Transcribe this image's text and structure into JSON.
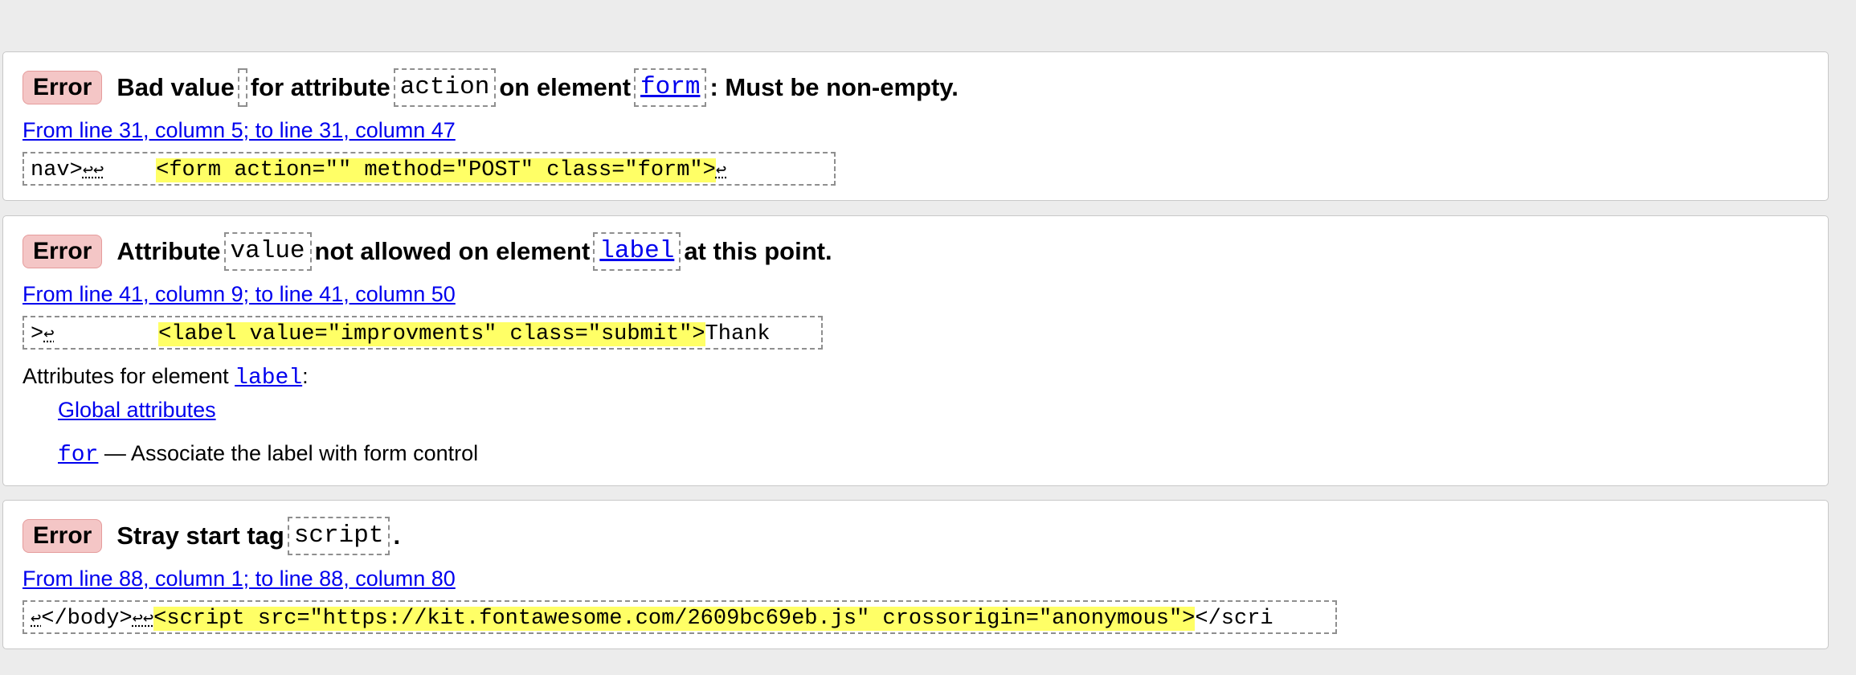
{
  "colors": {
    "page_bg": "#ececec",
    "error_badge_bg": "#f4c6c6",
    "link": "#0000ee",
    "highlight": "#ffff66"
  },
  "messages": [
    {
      "type_label": "Error",
      "text_1": "Bad value",
      "value_code": "",
      "text_2": "for attribute",
      "attr_code": "action",
      "text_3": "on element",
      "element_code": "form",
      "text_4": ": Must be non-empty.",
      "location": "From line 31, column 5; to line 31, column 47",
      "extract_before": "nav>",
      "extract_returns": "↩↩",
      "extract_mid": "    ",
      "extract_highlight": "<form action=\"\" method=\"POST\" class=\"form\">",
      "extract_after_return": "↩"
    },
    {
      "type_label": "Error",
      "text_1": "Attribute",
      "attr_code": "value",
      "text_2": "not allowed on element",
      "element_code": "label",
      "text_3": "at this point.",
      "location": "From line 41, column 9; to line 41, column 50",
      "extract_before": ">",
      "extract_returns": "↩",
      "extract_mid": "        ",
      "extract_highlight": "<label value=\"improvments\" class=\"submit\">",
      "extract_after": "Thank",
      "attributes_heading_prefix": "Attributes for element",
      "attributes_heading_code": "label",
      "attributes_heading_suffix": ":",
      "global_attributes_link": "Global attributes",
      "for_code": "for",
      "for_description": " — Associate the label with form control"
    },
    {
      "type_label": "Error",
      "text_1": "Stray start tag",
      "tag_code": "script",
      "text_2": ".",
      "location": "From line 88, column 1; to line 88, column 80",
      "extract_return_1": "↩",
      "extract_before": "</body>",
      "extract_returns": "↩↩",
      "extract_highlight": "<script src=\"https://kit.fontawesome.com/2609bc69eb.js\" crossorigin=\"anonymous\">",
      "extract_after": "</scri"
    }
  ]
}
